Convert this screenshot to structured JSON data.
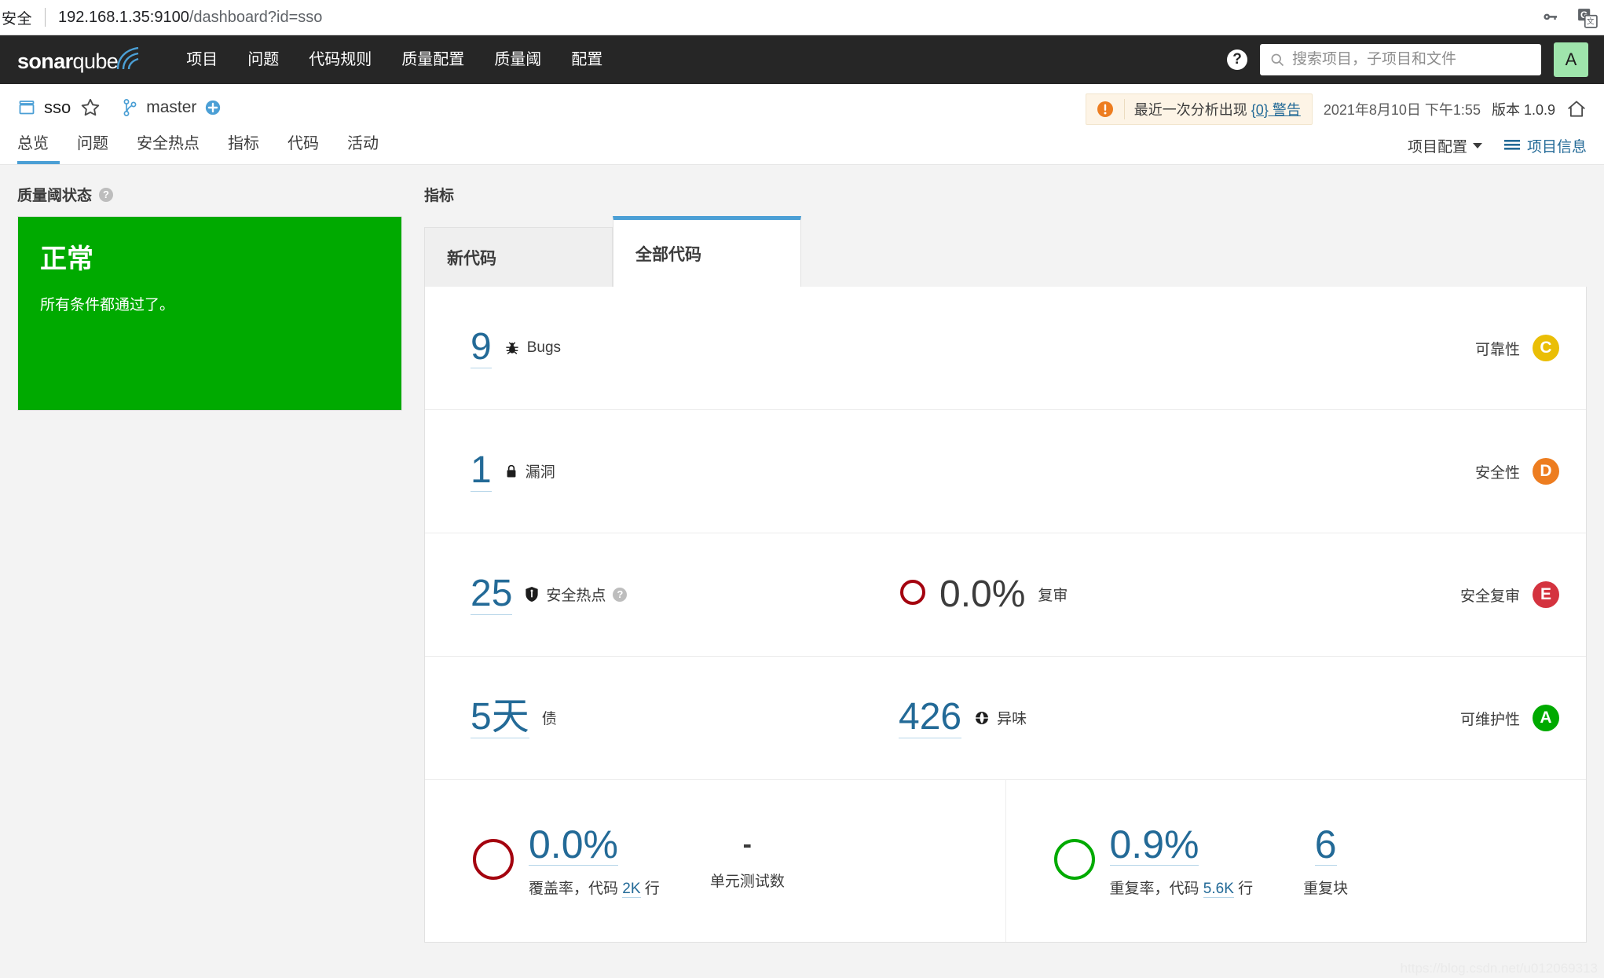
{
  "browser": {
    "secure_label": "安全",
    "url_host": "192.168.1.35:9100",
    "url_path": "/dashboard?id=sso",
    "key_icon": "key-icon",
    "translate_icon": "google-translate-icon"
  },
  "topnav": {
    "logo_bold": "sonar",
    "logo_light": "qube",
    "items": [
      {
        "label": "项目"
      },
      {
        "label": "问题"
      },
      {
        "label": "代码规则"
      },
      {
        "label": "质量配置"
      },
      {
        "label": "质量阈"
      },
      {
        "label": "配置"
      }
    ],
    "help_glyph": "?",
    "search": {
      "placeholder": "搜索项目，子项目和文件",
      "value": ""
    },
    "avatar": {
      "initial": "A",
      "color": "#9fe5ac"
    }
  },
  "project": {
    "name": "sso",
    "branch": "master",
    "warning_prefix": "最近一次分析出现 ",
    "warning_link": "{0} 警告",
    "analysis_date": "2021年8月10日 下午1:55",
    "version": "版本 1.0.9",
    "tabs": [
      {
        "label": "总览",
        "active": true
      },
      {
        "label": "问题",
        "active": false
      },
      {
        "label": "安全热点",
        "active": false
      },
      {
        "label": "指标",
        "active": false
      },
      {
        "label": "代码",
        "active": false
      },
      {
        "label": "活动",
        "active": false
      }
    ],
    "config_label": "项目配置",
    "info_label": "项目信息"
  },
  "quality_gate": {
    "section_title": "质量阈状态",
    "status": "正常",
    "description": "所有条件都通过了。",
    "color": "#00aa00"
  },
  "measures": {
    "section_title": "指标",
    "tabs": [
      {
        "label": "新代码",
        "active": false
      },
      {
        "label": "全部代码",
        "active": true
      }
    ],
    "rows": [
      {
        "primary_value": "9",
        "primary_label": "Bugs",
        "primary_icon": "bug-icon",
        "rating_label": "可靠性",
        "rating": "C",
        "rating_color": "#eabe06"
      },
      {
        "primary_value": "1",
        "primary_label": "漏洞",
        "primary_icon": "lock-icon",
        "rating_label": "安全性",
        "rating": "D",
        "rating_color": "#ed7d20"
      },
      {
        "primary_value": "25",
        "primary_label": "安全热点",
        "primary_icon": "shield-icon",
        "secondary_value": "0.0%",
        "secondary_label": "复审",
        "secondary_donut_color": "#a4030f",
        "rating_label": "安全复审",
        "rating": "E",
        "rating_color": "#d4333f"
      },
      {
        "primary_value": "5天",
        "primary_label": "债",
        "secondary_value": "426",
        "secondary_label": "异味",
        "secondary_icon": "code-smell-icon",
        "rating_label": "可维护性",
        "rating": "A",
        "rating_color": "#00aa00"
      }
    ],
    "coverage": {
      "donut_color": "#a4030f",
      "percent": "0.0%",
      "caption_prefix": "覆盖率，代码 ",
      "caption_link": "2K",
      "caption_suffix": " 行",
      "tests_value": "-",
      "tests_label": "单元测试数"
    },
    "duplication": {
      "donut_color": "#00aa00",
      "percent": "0.9%",
      "caption_prefix": "重复率，代码 ",
      "caption_link": "5.6K",
      "caption_suffix": " 行",
      "blocks_value": "6",
      "blocks_label": "重复块"
    }
  },
  "watermark": "https://blog.csdn.net/u012069313"
}
